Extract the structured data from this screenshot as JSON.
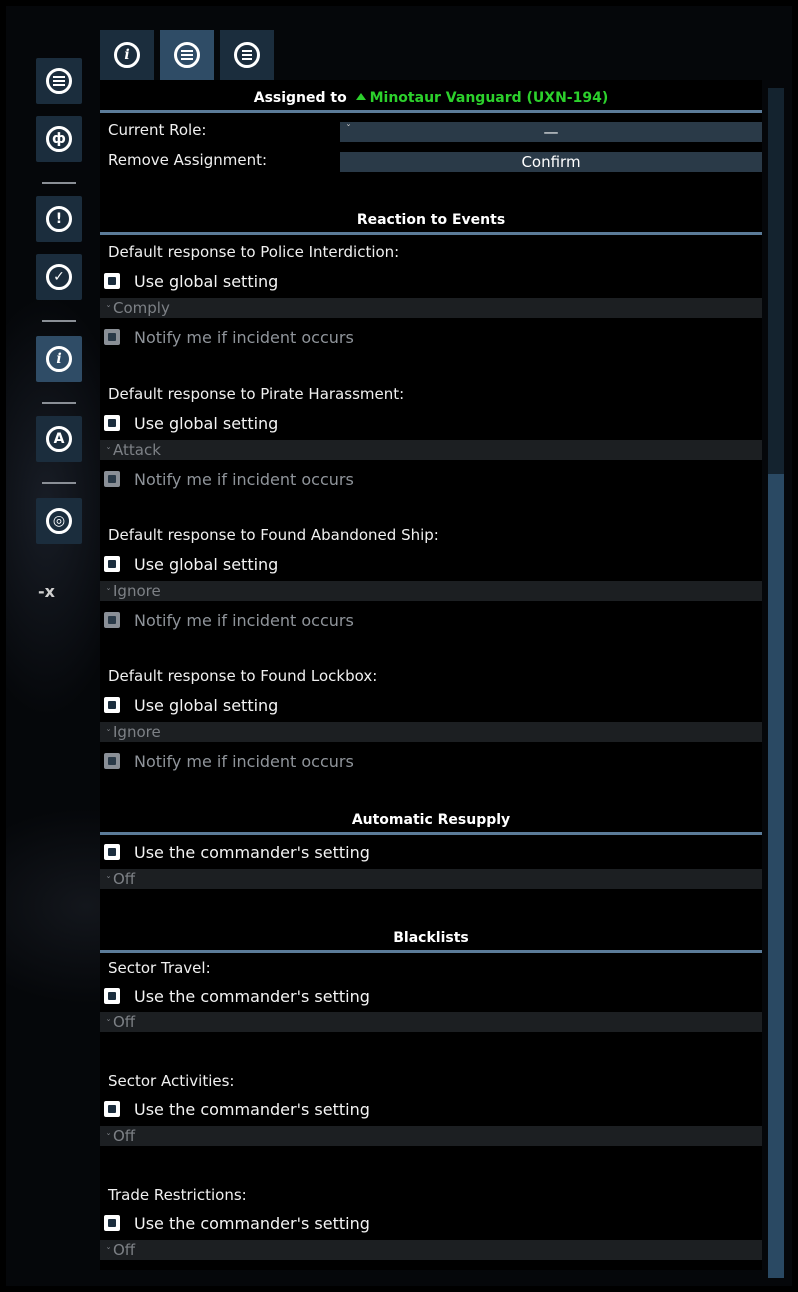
{
  "sidebar": {
    "buttons": [
      {
        "icon": "list-icon",
        "active": false
      },
      {
        "icon": "behaviour-icon",
        "active": false
      },
      {
        "icon": "alert-icon",
        "active": false
      },
      {
        "icon": "standing-orders-icon",
        "active": false
      },
      {
        "icon": "info-icon",
        "active": true
      },
      {
        "icon": "crew-icon",
        "active": false
      },
      {
        "icon": "fingerprint-icon",
        "active": false
      }
    ],
    "close_label": "-x"
  },
  "topbar": {
    "buttons": [
      {
        "icon": "info-icon",
        "active": false
      },
      {
        "icon": "list-icon",
        "active": true
      },
      {
        "icon": "detail-list-icon",
        "active": false
      }
    ]
  },
  "assignment": {
    "assigned_prefix": "Assigned to",
    "commander": "Minotaur Vanguard (UXN-194)",
    "current_role_label": "Current Role:",
    "current_role_value": "—",
    "remove_label": "Remove Assignment:",
    "remove_button": "Confirm"
  },
  "reaction": {
    "header": "Reaction to Events",
    "items": [
      {
        "title": "Default response to Police Interdiction:",
        "global": "Use global setting",
        "value": "Comply",
        "notify": "Notify me if incident occurs"
      },
      {
        "title": "Default response to Pirate Harassment:",
        "global": "Use global setting",
        "value": "Attack",
        "notify": "Notify me if incident occurs"
      },
      {
        "title": "Default response to Found Abandoned Ship:",
        "global": "Use global setting",
        "value": "Ignore",
        "notify": "Notify me if incident occurs"
      },
      {
        "title": "Default response to Found Lockbox:",
        "global": "Use global setting",
        "value": "Ignore",
        "notify": "Notify me if incident occurs"
      }
    ]
  },
  "resupply": {
    "header": "Automatic Resupply",
    "setting": "Use the commander's setting",
    "value": "Off"
  },
  "blacklists": {
    "header": "Blacklists",
    "items": [
      {
        "title": "Sector Travel:",
        "setting": "Use the commander's setting",
        "value": "Off"
      },
      {
        "title": "Sector Activities:",
        "setting": "Use the commander's setting",
        "value": "Off"
      },
      {
        "title": "Trade Restrictions:",
        "setting": "Use the commander's setting",
        "value": "Off"
      }
    ]
  },
  "colors": {
    "accent_green": "#2cd12c",
    "panel_button": "#1b2d3d",
    "panel_button_active": "#2f4c66",
    "header_rule": "#5b7b98"
  }
}
